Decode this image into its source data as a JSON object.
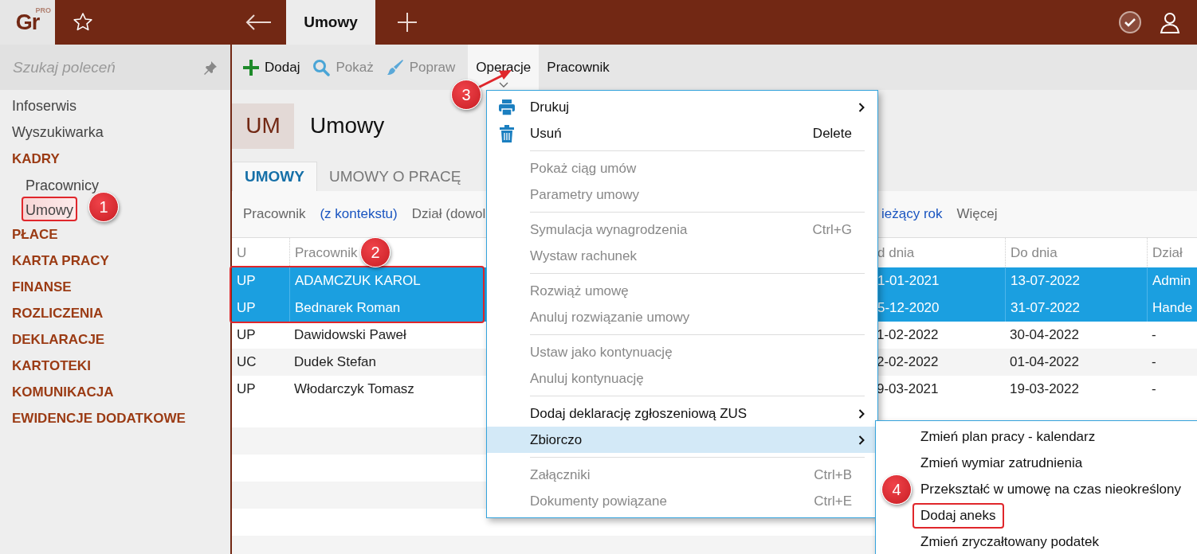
{
  "topbar": {
    "logo": "Gr",
    "logo_badge": "PRO",
    "tab": "Umowy"
  },
  "sidebar": {
    "search": {
      "placeholder": "Szukaj poleceń"
    },
    "items": [
      {
        "label": "Infoserwis",
        "kind": "link",
        "selected": false
      },
      {
        "label": "Wyszukiwarka",
        "kind": "link",
        "selected": false
      },
      {
        "label": "KADRY",
        "kind": "section",
        "selected": false,
        "children": [
          {
            "label": "Pracownicy",
            "selected": false,
            "annotated": false
          },
          {
            "label": "Umowy",
            "selected": true,
            "annotated": true
          }
        ]
      },
      {
        "label": "PŁACE",
        "kind": "section",
        "selected": false
      },
      {
        "label": "KARTA PRACY",
        "kind": "section",
        "selected": false
      },
      {
        "label": "FINANSE",
        "kind": "section",
        "selected": false
      },
      {
        "label": "ROZLICZENIA",
        "kind": "section",
        "selected": false
      },
      {
        "label": "DEKLARACJE",
        "kind": "section",
        "selected": false
      },
      {
        "label": "KARTOTEKI",
        "kind": "section",
        "selected": false
      },
      {
        "label": "KOMUNIKACJA",
        "kind": "section",
        "selected": false
      },
      {
        "label": "EWIDENCJE DODATKOWE",
        "kind": "section",
        "selected": false
      }
    ]
  },
  "toolbar": [
    {
      "label": "Dodaj",
      "kind": "add",
      "disabled": false
    },
    {
      "label": "Pokaż",
      "kind": "view",
      "disabled": true
    },
    {
      "label": "Popraw",
      "kind": "edit",
      "disabled": true
    },
    {
      "label": "Operacje",
      "kind": "menu",
      "expanded": true
    },
    {
      "label": "Pracownik",
      "kind": "menu",
      "expanded": false
    }
  ],
  "page_header": {
    "badge": "UM",
    "title": "Umowy"
  },
  "tabs": [
    {
      "label": "UMOWY",
      "selected": true
    },
    {
      "label": "UMOWY O PRACĘ",
      "selected": false
    }
  ],
  "filters": {
    "left": [
      {
        "label": "Pracownik",
        "value": "(z kontekstu)"
      },
      {
        "label": "Dział (dowol"
      }
    ],
    "right": [
      {
        "value": "ieżący rok"
      },
      {
        "label": "Więcej"
      }
    ]
  },
  "table": {
    "columns": [
      "U",
      "Pracownik",
      "d dnia",
      "Do dnia",
      "Dział"
    ],
    "rows": [
      {
        "cells": [
          "UP",
          "ADAMCZUK KAROL",
          "1-01-2021",
          "13-07-2022",
          "Admin"
        ],
        "selected": true,
        "annotated": true
      },
      {
        "cells": [
          "UP",
          "Bednarek Roman",
          "5-12-2020",
          "31-07-2022",
          "Hande"
        ],
        "selected": true,
        "annotated": true
      },
      {
        "cells": [
          "UP",
          "Dawidowski Paweł",
          "1-02-2022",
          "30-04-2022",
          "-"
        ],
        "selected": false,
        "annotated": false
      },
      {
        "cells": [
          "UC",
          "Dudek Stefan",
          "2-02-2022",
          "01-04-2022",
          "-"
        ],
        "selected": false,
        "annotated": false
      },
      {
        "cells": [
          "UP",
          "Włodarczyk Tomasz",
          "9-03-2021",
          "19-03-2022",
          "-"
        ],
        "selected": false,
        "annotated": false
      }
    ]
  },
  "menu": {
    "items": [
      {
        "kind": "item",
        "label": "Drukuj",
        "submenu": true,
        "disabled": false,
        "selected": false
      },
      {
        "kind": "item",
        "label": "Usuń",
        "shortcut": "Delete",
        "disabled": false,
        "selected": false
      },
      {
        "kind": "separator"
      },
      {
        "kind": "item",
        "label": "Pokaż ciąg umów",
        "disabled": true,
        "selected": false
      },
      {
        "kind": "item",
        "label": "Parametry umowy",
        "disabled": true,
        "selected": false
      },
      {
        "kind": "separator"
      },
      {
        "kind": "item",
        "label": "Symulacja wynagrodzenia",
        "shortcut": "Ctrl+G",
        "disabled": true,
        "selected": false
      },
      {
        "kind": "item",
        "label": "Wystaw rachunek",
        "disabled": true,
        "selected": false
      },
      {
        "kind": "separator"
      },
      {
        "kind": "item",
        "label": "Rozwiąż umowę",
        "disabled": true,
        "selected": false
      },
      {
        "kind": "item",
        "label": "Anuluj rozwiązanie umowy",
        "disabled": true,
        "selected": false
      },
      {
        "kind": "separator"
      },
      {
        "kind": "item",
        "label": "Ustaw jako kontynuację",
        "disabled": true,
        "selected": false
      },
      {
        "kind": "item",
        "label": "Anuluj kontynuację",
        "disabled": true,
        "selected": false
      },
      {
        "kind": "separator"
      },
      {
        "kind": "item",
        "label": "Dodaj deklarację zgłoszeniową ZUS",
        "submenu": true,
        "disabled": false,
        "selected": false
      },
      {
        "kind": "item",
        "label": "Zbiorczo",
        "submenu": true,
        "disabled": false,
        "selected": true
      },
      {
        "kind": "separator"
      },
      {
        "kind": "item",
        "label": "Załączniki",
        "shortcut": "Ctrl+B",
        "disabled": true,
        "selected": false
      },
      {
        "kind": "item",
        "label": "Dokumenty powiązane",
        "shortcut": "Ctrl+E",
        "disabled": true,
        "selected": false
      }
    ]
  },
  "submenu": {
    "items": [
      {
        "label": "Zmień plan pracy - kalendarz",
        "annotated": false
      },
      {
        "label": "Zmień wymiar zatrudnienia",
        "annotated": false
      },
      {
        "label": "Przekształć w umowę na czas nieokreślony",
        "annotated": false
      },
      {
        "label": "Dodaj aneks",
        "annotated": true
      },
      {
        "label": "Zmień zryczałtowany podatek",
        "annotated": false
      }
    ]
  },
  "callouts": [
    {
      "label": "1"
    },
    {
      "label": "2"
    },
    {
      "label": "3",
      "arrow": true
    },
    {
      "label": "4"
    }
  ]
}
